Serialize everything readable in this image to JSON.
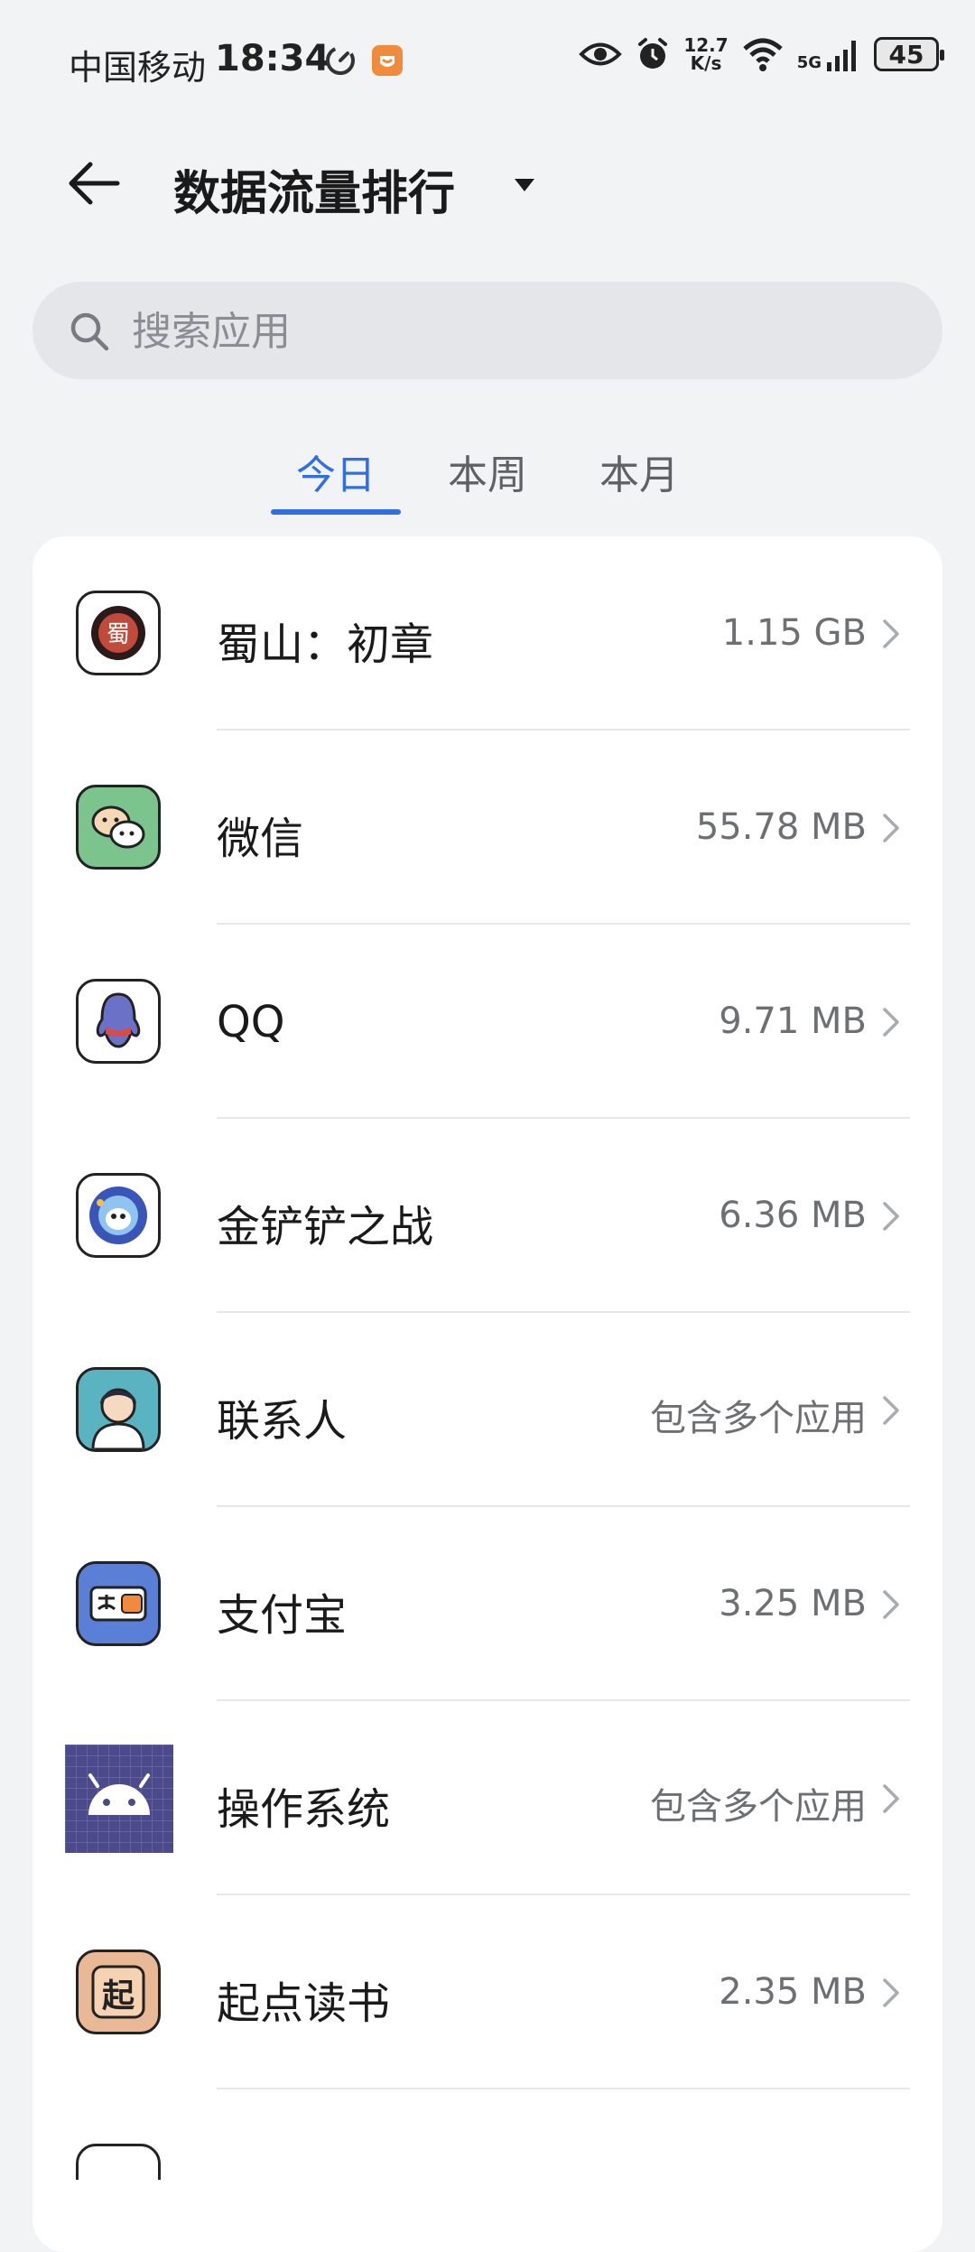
{
  "status_bar": {
    "carrier": "中国移动",
    "time": "18:34",
    "net_speed_value": "12.7",
    "net_speed_unit": "K/s",
    "signal_label": "5G",
    "battery": "45"
  },
  "header": {
    "title": "数据流量排行"
  },
  "search": {
    "placeholder": "搜索应用"
  },
  "tabs": [
    {
      "label": "今日",
      "active": true
    },
    {
      "label": "本周",
      "active": false
    },
    {
      "label": "本月",
      "active": false
    }
  ],
  "apps": [
    {
      "name": "蜀山：初章",
      "usage": "1.15 GB",
      "icon": "shushan-game-icon"
    },
    {
      "name": "微信",
      "usage": "55.78 MB",
      "icon": "wechat-icon"
    },
    {
      "name": "QQ",
      "usage": "9.71 MB",
      "icon": "qq-icon"
    },
    {
      "name": "金铲铲之战",
      "usage": "6.36 MB",
      "icon": "jinchanchan-game-icon"
    },
    {
      "name": "联系人",
      "usage": "包含多个应用",
      "icon": "contacts-icon"
    },
    {
      "name": "支付宝",
      "usage": "3.25 MB",
      "icon": "alipay-icon"
    },
    {
      "name": "操作系统",
      "usage": "包含多个应用",
      "icon": "android-system-icon"
    },
    {
      "name": "起点读书",
      "usage": "2.35 MB",
      "icon": "qidian-reader-icon"
    }
  ],
  "colors": {
    "accent": "#2f6ee6",
    "background": "#f1f3f5",
    "card": "#ffffff"
  }
}
